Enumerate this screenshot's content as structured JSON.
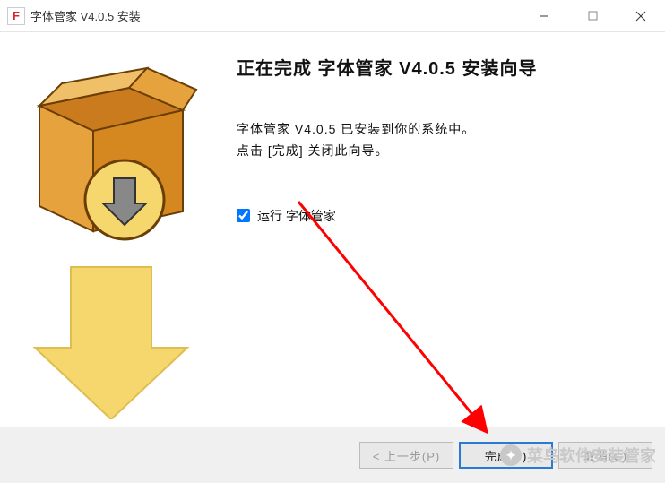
{
  "titlebar": {
    "icon_letter": "F",
    "title": "字体管家 V4.0.5 安装"
  },
  "main": {
    "heading": "正在完成 字体管家 V4.0.5 安装向导",
    "body_line1": "字体管家 V4.0.5 已安装到你的系统中。",
    "body_line2": "点击 [完成] 关闭此向导。",
    "checkbox_label": "运行 字体管家"
  },
  "footer": {
    "back_label": "< 上一步(P)",
    "finish_label": "完成(F)",
    "cancel_label": "取消(C)"
  },
  "watermark": {
    "text": "菜鸟软件安装管家"
  }
}
